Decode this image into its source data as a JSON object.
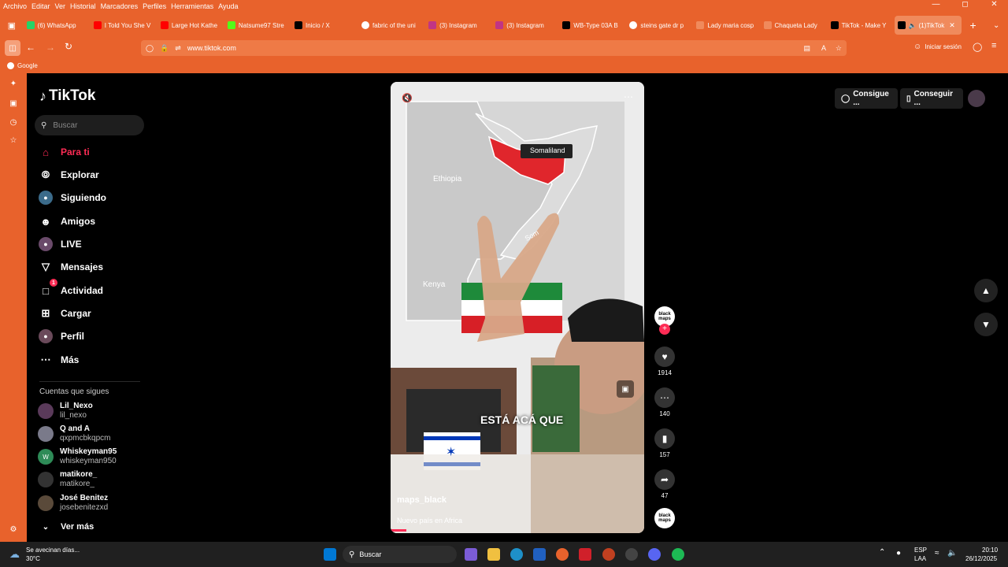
{
  "menu": [
    "Archivo",
    "Editar",
    "Ver",
    "Historial",
    "Marcadores",
    "Perfiles",
    "Herramientas",
    "Ayuda"
  ],
  "tabs": [
    {
      "label": "(6) WhatsApp",
      "color": "#25d366"
    },
    {
      "label": "I Told You She V",
      "color": "#ff0000"
    },
    {
      "label": "Large Hot Kathe",
      "color": "#ff0000"
    },
    {
      "label": "Natsume97 Stre",
      "color": "#53fc18"
    },
    {
      "label": "Inicio / X",
      "color": "#000000"
    },
    {
      "label": "fabric of the uni",
      "color": "#ffffff"
    },
    {
      "label": "(3) Instagram",
      "color": "#c13584"
    },
    {
      "label": "(3) Instagram",
      "color": "#c13584"
    },
    {
      "label": "WB-Type 03A B",
      "color": "#000000"
    },
    {
      "label": "steins gate dr p",
      "color": "#ffffff"
    },
    {
      "label": "Lady maria cosp",
      "color": "#e8622c"
    },
    {
      "label": "Chaqueta Lady",
      "color": "#e8622c"
    },
    {
      "label": "TikTok - Make Y",
      "color": "#000000"
    },
    {
      "label": "(1)TikTok",
      "color": "#000000"
    }
  ],
  "url": "www.tiktok.com",
  "signin": "Iniciar sesión",
  "bookmark": "Google",
  "tiktok": {
    "logo": "TikTok",
    "search_placeholder": "Buscar",
    "nav": [
      "Para ti",
      "Explorar",
      "Siguiendo",
      "Amigos",
      "LIVE",
      "Mensajes",
      "Actividad",
      "Cargar",
      "Perfil",
      "Más"
    ],
    "activity_badge": "1",
    "following_title": "Cuentas que sigues",
    "following": [
      {
        "name": "Lil_Nexo",
        "user": "lil_nexo"
      },
      {
        "name": "Q and A",
        "user": "qxpmcbkqpcm"
      },
      {
        "name": "Whiskeyman95",
        "user": "whiskeyman950"
      },
      {
        "name": "matikore_",
        "user": "matikore_"
      },
      {
        "name": "José Benitez",
        "user": "josebenitezxd"
      }
    ],
    "more": "Ver más",
    "top_buttons": [
      "Consigue ...",
      "Conseguir ..."
    ],
    "video": {
      "map_labels": [
        "Somaliland",
        "Ethiopia",
        "Kenya",
        "Som"
      ],
      "caption": "ESTÁ ACÁ QUE",
      "user": "maps_black",
      "desc": "Nuevo país en Africa",
      "avatar": "black maps"
    },
    "actions": {
      "likes": "1914",
      "comments": "140",
      "saves": "157",
      "shares": "47"
    }
  },
  "taskbar": {
    "weather": "Se avecinan días...",
    "temp": "30°C",
    "search": "Buscar",
    "lang": "ESP",
    "lang2": "LAA",
    "time": "20:10",
    "date": "26/12/2025"
  }
}
